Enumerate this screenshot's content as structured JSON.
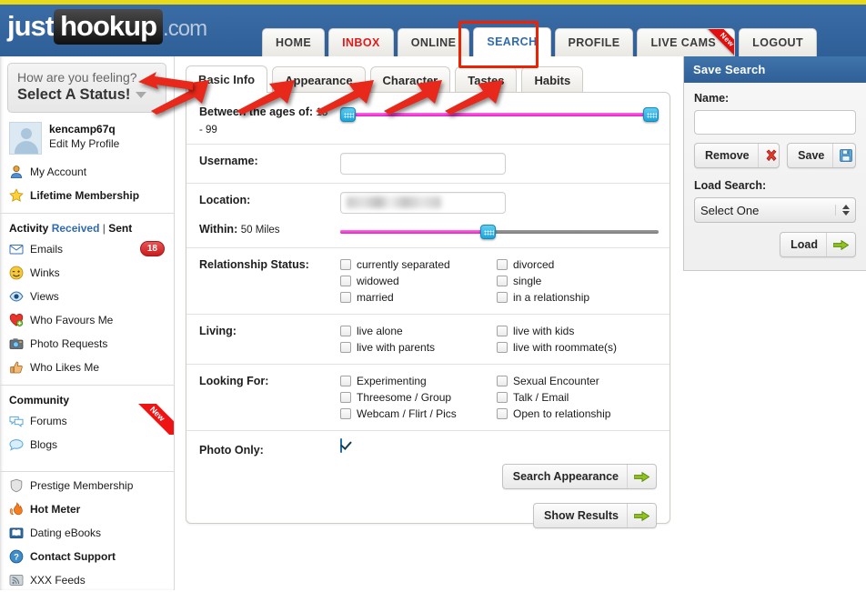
{
  "brand": {
    "part1": "just",
    "part2": "hookup",
    "part3": ".com"
  },
  "mainnav": {
    "items": [
      {
        "label": "HOME",
        "state": "normal",
        "ribbon": null
      },
      {
        "label": "INBOX",
        "state": "inbox",
        "ribbon": null
      },
      {
        "label": "ONLINE",
        "state": "normal",
        "ribbon": null
      },
      {
        "label": "SEARCH",
        "state": "active",
        "ribbon": null
      },
      {
        "label": "PROFILE",
        "state": "normal",
        "ribbon": null
      },
      {
        "label": "LIVE CAMS",
        "state": "normal",
        "ribbon": "New"
      },
      {
        "label": "LOGOUT",
        "state": "normal",
        "ribbon": null
      }
    ]
  },
  "sidebar": {
    "status": {
      "question": "How are you feeling?",
      "value": "Select A Status!"
    },
    "user": {
      "name": "kencamp67q",
      "edit_label": "Edit My Profile"
    },
    "account_links": [
      {
        "label": "My Account",
        "icon": "person-icon",
        "bold": false
      },
      {
        "label": "Lifetime Membership",
        "icon": "star-icon",
        "bold": true
      }
    ],
    "activity": {
      "title": "Activity",
      "received": "Received",
      "separator": "|",
      "sent": "Sent"
    },
    "activity_links": [
      {
        "label": "Emails",
        "icon": "envelope-icon",
        "badge": "18"
      },
      {
        "label": "Winks",
        "icon": "wink-icon",
        "badge": null
      },
      {
        "label": "Views",
        "icon": "eye-icon",
        "badge": null
      },
      {
        "label": "Who Favours Me",
        "icon": "heart-icon",
        "badge": null
      },
      {
        "label": "Photo Requests",
        "icon": "camera-icon",
        "badge": null
      },
      {
        "label": "Who Likes Me",
        "icon": "thumbs-up-icon",
        "badge": null
      }
    ],
    "community": {
      "title": "Community"
    },
    "community_links": [
      {
        "label": "Forums",
        "icon": "chat-bubbles-icon",
        "ribbon": "New"
      },
      {
        "label": "Blogs",
        "icon": "speech-bubble-icon",
        "ribbon": null
      }
    ],
    "extra_links": [
      {
        "label": "Prestige Membership",
        "icon": "shield-icon",
        "bold": false
      },
      {
        "label": "Hot Meter",
        "icon": "flame-icon",
        "bold": true
      },
      {
        "label": "Dating eBooks",
        "icon": "book-icon",
        "bold": false
      },
      {
        "label": "Contact Support",
        "icon": "help-icon",
        "bold": true
      },
      {
        "label": "XXX Feeds",
        "icon": "rss-icon",
        "bold": false
      }
    ]
  },
  "subtabs": [
    {
      "label": "Basic Info",
      "active": true
    },
    {
      "label": "Appearance",
      "active": false
    },
    {
      "label": "Character",
      "active": false
    },
    {
      "label": "Tastes",
      "active": false
    },
    {
      "label": "Habits",
      "active": false
    }
  ],
  "form": {
    "age": {
      "label": "Between the ages of:",
      "min": "18",
      "max": "- 99",
      "min_pct": 0,
      "max_pct": 96
    },
    "username": {
      "label": "Username:",
      "value": "",
      "placeholder": ""
    },
    "location": {
      "label": "Location:",
      "value": "",
      "redacted": true
    },
    "within": {
      "label": "Within:",
      "value": "50 Miles",
      "pct": 46
    },
    "relationship": {
      "label": "Relationship Status:",
      "left": [
        {
          "label": "currently separated",
          "checked": false
        },
        {
          "label": "widowed",
          "checked": false
        },
        {
          "label": "married",
          "checked": false
        }
      ],
      "right": [
        {
          "label": "divorced",
          "checked": false
        },
        {
          "label": "single",
          "checked": false
        },
        {
          "label": "in a relationship",
          "checked": false
        }
      ]
    },
    "living": {
      "label": "Living:",
      "left": [
        {
          "label": "live alone",
          "checked": false
        },
        {
          "label": "live with parents",
          "checked": false
        }
      ],
      "right": [
        {
          "label": "live with kids",
          "checked": false
        },
        {
          "label": "live with roommate(s)",
          "checked": false
        }
      ]
    },
    "looking_for": {
      "label": "Looking For:",
      "left": [
        {
          "label": "Experimenting",
          "checked": false
        },
        {
          "label": "Threesome / Group",
          "checked": false
        },
        {
          "label": "Webcam / Flirt / Pics",
          "checked": false
        }
      ],
      "right": [
        {
          "label": "Sexual Encounter",
          "checked": false
        },
        {
          "label": "Talk / Email",
          "checked": false
        },
        {
          "label": "Open to relationship",
          "checked": false
        }
      ]
    },
    "photo_only": {
      "label": "Photo Only:",
      "checked": true
    },
    "buttons": [
      {
        "label": "Search Appearance",
        "icon": "green-arrow-icon"
      },
      {
        "label": "Show Results",
        "icon": "green-arrow-icon"
      }
    ]
  },
  "save_search": {
    "title": "Save Search",
    "name_label": "Name:",
    "name_value": "",
    "remove_label": "Remove",
    "save_label": "Save",
    "load_label": "Load Search:",
    "selected_option": "Select One",
    "load_button": "Load"
  },
  "colors": {
    "header_blue": "#34679f",
    "top_strip_yellow": "#e8d91b",
    "accent_red": "#ee2200",
    "slider_pink": "#f23ed6",
    "slider_handle": "#1ba6dd",
    "inbox_red": "#e01b1b",
    "active_tab_blue": "#2f6bb0"
  }
}
